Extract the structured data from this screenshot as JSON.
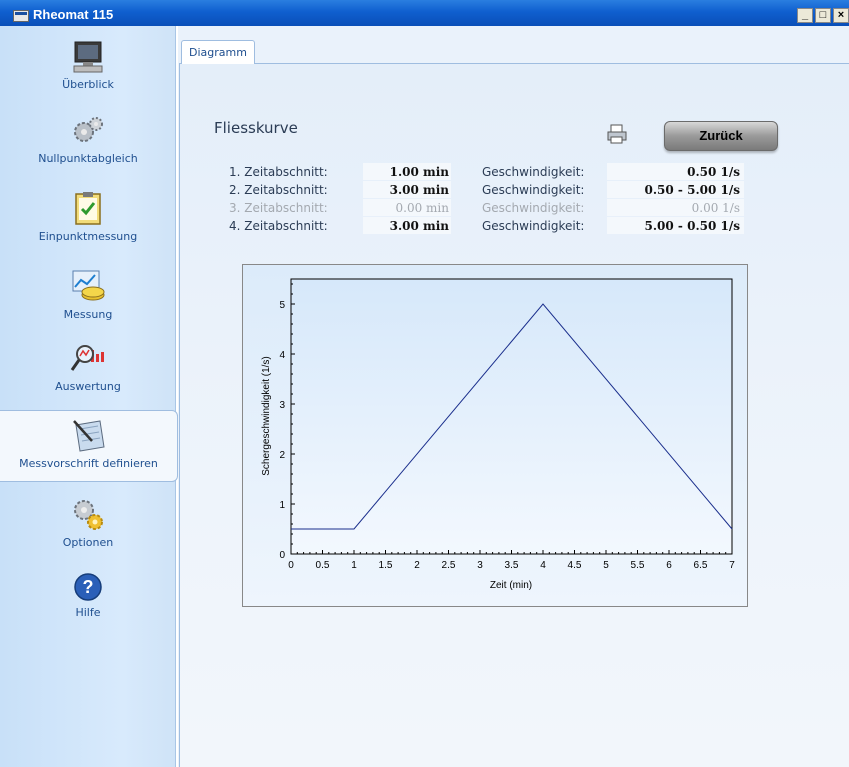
{
  "window": {
    "title": "Rheomat 115",
    "buttons": [
      "_",
      "□",
      "×"
    ]
  },
  "sidebar": {
    "items": [
      {
        "label": "Überblick",
        "icon": "computer-icon"
      },
      {
        "label": "Nullpunktabgleich",
        "icon": "gears-icon"
      },
      {
        "label": "Einpunktmessung",
        "icon": "clipboard-check-icon"
      },
      {
        "label": "Messung",
        "icon": "measurement-icon"
      },
      {
        "label": "Auswertung",
        "icon": "analysis-icon"
      },
      {
        "label": "Messvorschrift definieren",
        "icon": "define-protocol-icon",
        "active": true
      },
      {
        "label": "Optionen",
        "icon": "options-gears-icon"
      },
      {
        "label": "Hilfe",
        "icon": "help-icon"
      }
    ]
  },
  "tab": {
    "label": "Diagramm"
  },
  "main": {
    "heading": "Fliesskurve",
    "back_button": "Zurück",
    "printer_icon": "printer-icon"
  },
  "segments": [
    {
      "label": "1. Zeitabschnitt:",
      "time": "1.00 min",
      "speed_label": "Geschwindigkeit:",
      "speed": "0.50  1/s",
      "enabled": true
    },
    {
      "label": "2. Zeitabschnitt:",
      "time": "3.00 min",
      "speed_label": "Geschwindigkeit:",
      "speed": "0.50 - 5.00  1/s",
      "enabled": true
    },
    {
      "label": "3. Zeitabschnitt:",
      "time": "0.00 min",
      "speed_label": "Geschwindigkeit:",
      "speed": "0.00  1/s",
      "enabled": false
    },
    {
      "label": "4. Zeitabschnitt:",
      "time": "3.00 min",
      "speed_label": "Geschwindigkeit:",
      "speed": "5.00 - 0.50  1/s",
      "enabled": true
    }
  ],
  "chart_data": {
    "type": "line",
    "xlabel": "Zeit (min)",
    "ylabel": "Schergeschwindigkeit (1/s)",
    "xlim": [
      0,
      7
    ],
    "ylim": [
      0,
      5.5
    ],
    "x_ticks": [
      "0",
      "0.5",
      "1",
      "1.5",
      "2",
      "2.5",
      "3",
      "3.5",
      "4",
      "4.5",
      "5",
      "5.5",
      "6",
      "6.5",
      "7"
    ],
    "y_ticks": [
      "0",
      "1",
      "2",
      "3",
      "4",
      "5"
    ],
    "series": [
      {
        "x": [
          0,
          1,
          4,
          7
        ],
        "y": [
          0.5,
          0.5,
          5.0,
          0.5
        ],
        "color": "#1a2e8c"
      }
    ],
    "grid": false
  }
}
